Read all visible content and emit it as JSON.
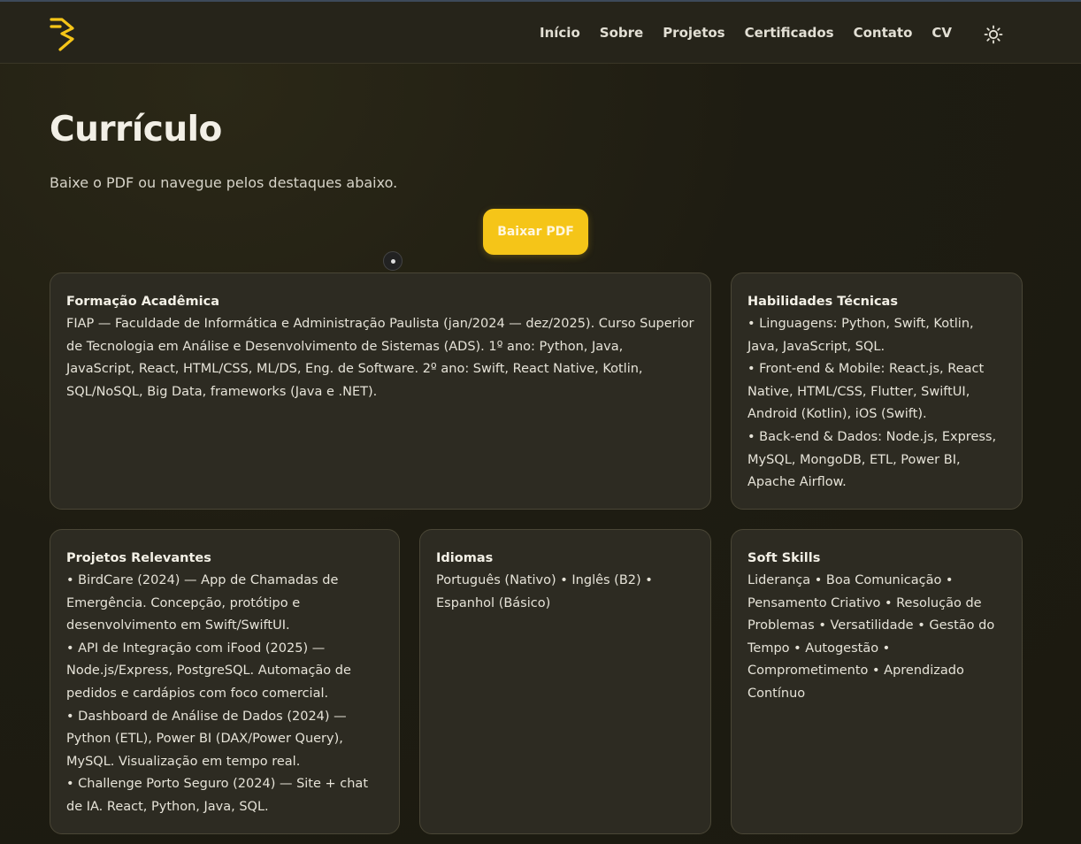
{
  "nav": {
    "items": [
      "Início",
      "Sobre",
      "Projetos",
      "Certificados",
      "Contato",
      "CV"
    ],
    "logo_icon": "logo-3-icon",
    "theme_icon": "sun-icon"
  },
  "page": {
    "title": "Currículo",
    "subtitle": "Baixe o PDF ou navegue pelos destaques abaixo.",
    "download_label": "Baixar PDF"
  },
  "colors": {
    "accent": "#f5c518",
    "card_bg": "#2d2b22",
    "page_bg": "#1e1c12"
  },
  "cards": {
    "formacao": {
      "title": "Formação Acadêmica",
      "text": "FIAP — Faculdade de Informática e Administração Paulista (jan/2024 — dez/2025). Curso Superior de Tecnologia em Análise e Desenvolvimento de Sistemas (ADS). 1º ano: Python, Java, JavaScript, React, HTML/CSS, ML/DS, Eng. de Software. 2º ano: Swift, React Native, Kotlin, SQL/NoSQL, Big Data, frameworks (Java e .NET)."
    },
    "habilidades": {
      "title": "Habilidades Técnicas",
      "items": [
        "• Linguagens: Python, Swift, Kotlin, Java, JavaScript, SQL.",
        "• Front-end & Mobile: React.js, React Native, HTML/CSS, Flutter, SwiftUI, Android (Kotlin), iOS (Swift).",
        "• Back-end & Dados: Node.js, Express, MySQL, MongoDB, ETL, Power BI, Apache Airflow."
      ]
    },
    "projetos": {
      "title": "Projetos Relevantes",
      "items": [
        "• BirdCare (2024) — App de Chamadas de Emergência. Concepção, protótipo e desenvolvimento em Swift/SwiftUI.",
        "• API de Integração com iFood (2025) — Node.js/Express, PostgreSQL. Automação de pedidos e cardápios com foco comercial.",
        "• Dashboard de Análise de Dados (2024) — Python (ETL), Power BI (DAX/Power Query), MySQL. Visualização em tempo real.",
        "• Challenge Porto Seguro (2024) — Site + chat de IA. React, Python, Java, SQL."
      ]
    },
    "idiomas": {
      "title": "Idiomas",
      "text": "Português (Nativo) • Inglês (B2) • Espanhol (Básico)"
    },
    "softskills": {
      "title": "Soft Skills",
      "text": "Liderança • Boa Comunicação • Pensamento Criativo • Resolução de Problemas • Versatilidade • Gestão do Tempo • Autogestão • Comprometimento • Aprendizado Contínuo"
    }
  }
}
